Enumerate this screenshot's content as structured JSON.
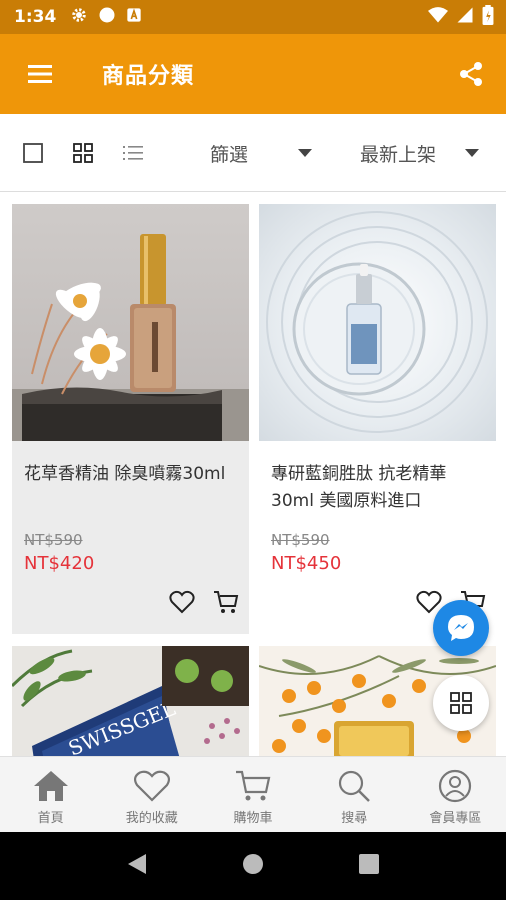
{
  "status_bar": {
    "time": "1:34",
    "left_icons": [
      "gear-icon",
      "circle-icon",
      "a-badge-icon"
    ],
    "right_icons": [
      "wifi-icon",
      "signal-icon",
      "battery-icon"
    ]
  },
  "app_bar": {
    "title": "商品分類",
    "color": "#ef9609"
  },
  "toolbar": {
    "view_modes": [
      "single-view-icon",
      "grid-view-icon",
      "list-view-icon"
    ],
    "filter_label": "篩選",
    "sort_label": "最新上架"
  },
  "products": [
    {
      "name": "花草香精油 除臭噴霧30ml",
      "old_price": "NT$590",
      "price": "NT$420"
    },
    {
      "name": "專研藍銅胜肽 抗老精華30ml 美國原料進口",
      "old_price": "NT$590",
      "price": "NT$450"
    },
    {
      "name": "",
      "old_price": "",
      "price": ""
    },
    {
      "name": "",
      "old_price": "",
      "price": ""
    }
  ],
  "bottom_nav": {
    "items": [
      {
        "label": "首頁",
        "icon": "home-icon"
      },
      {
        "label": "我的收藏",
        "icon": "heart-icon"
      },
      {
        "label": "購物車",
        "icon": "cart-icon"
      },
      {
        "label": "搜尋",
        "icon": "search-icon"
      },
      {
        "label": "會員專區",
        "icon": "user-icon"
      }
    ]
  },
  "colors": {
    "accent": "#ef9609",
    "status_bar": "#c97d06",
    "price_red": "#e5333a",
    "messenger": "#1e88e5"
  }
}
